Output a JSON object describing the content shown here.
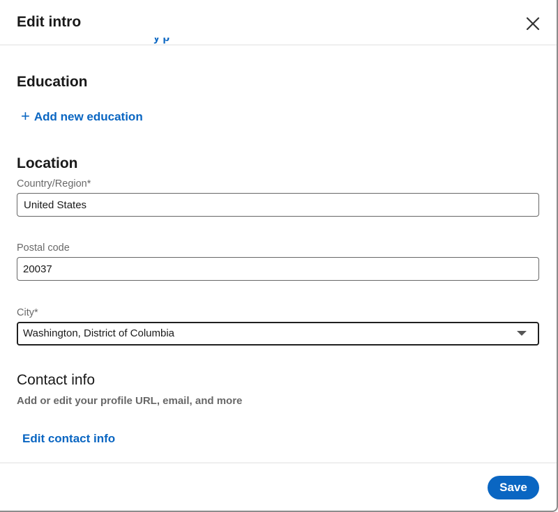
{
  "modal": {
    "title": "Edit intro",
    "close_icon": "close-icon"
  },
  "scroll_peek": {
    "text": "y p"
  },
  "education": {
    "heading": "Education",
    "add_icon": "plus-icon",
    "add_label": "Add new education"
  },
  "location": {
    "heading": "Location",
    "country_label": "Country/Region*",
    "country_value": "United States",
    "postal_label": "Postal code",
    "postal_value": "20037",
    "city_label": "City*",
    "city_value": "Washington, District of Columbia",
    "city_caret_icon": "caret-down-icon"
  },
  "contact": {
    "heading": "Contact info",
    "subtext": "Add or edit your profile URL, email, and more",
    "edit_label": "Edit contact info"
  },
  "footer": {
    "save_label": "Save"
  },
  "colors": {
    "accent": "#0a66c2",
    "text_primary": "#1f1f1f",
    "text_secondary": "#666666",
    "divider": "#e0e0e0"
  }
}
